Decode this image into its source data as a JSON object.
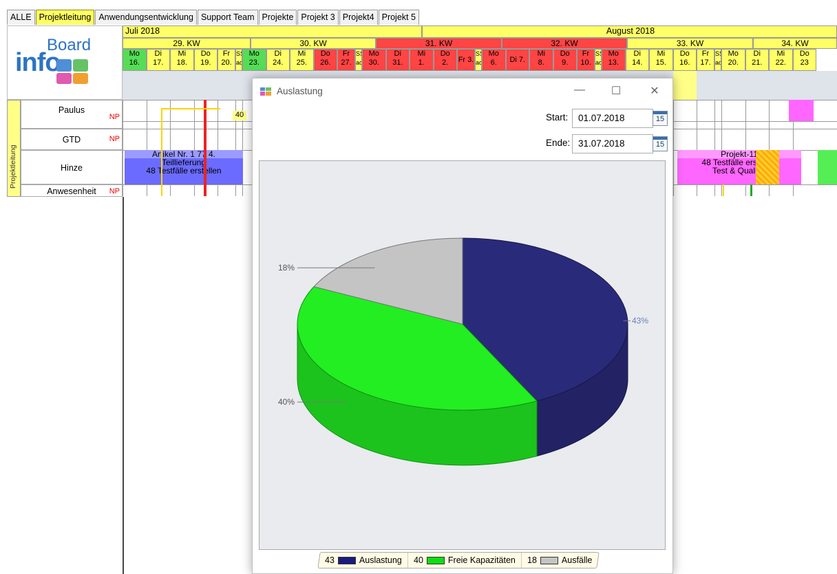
{
  "tabs": [
    {
      "label": "ALLE",
      "active": false
    },
    {
      "label": "Projektleitung",
      "active": true
    },
    {
      "label": "Anwendungsentwicklung",
      "active": false
    },
    {
      "label": "Support Team",
      "active": false
    },
    {
      "label": "Projekte",
      "active": false
    },
    {
      "label": "Projekt 3",
      "active": false
    },
    {
      "label": "Projekt4",
      "active": false
    },
    {
      "label": "Projekt 5",
      "active": false
    }
  ],
  "logo": {
    "word1": "Board",
    "word2": "info"
  },
  "group_label": "Projektleitung",
  "rows": [
    {
      "name": "Paulus",
      "np": "NP"
    },
    {
      "name": "GTD",
      "np": "NP"
    },
    {
      "name": "Hinze",
      "np": ""
    },
    {
      "name": "Anwesenheit",
      "np": "NP"
    }
  ],
  "calendar": {
    "months": [
      "Juli 2018",
      "August 2018"
    ],
    "weeks": [
      {
        "label": "29. KW",
        "color": "#ffff66"
      },
      {
        "label": "30. KW",
        "color": "#ffff66"
      },
      {
        "label": "31. KW",
        "color": "#ff4444"
      },
      {
        "label": "32. KW",
        "color": "#ff4444"
      },
      {
        "label": "33. KW",
        "color": "#ffff66"
      },
      {
        "label": "34. KW",
        "color": "#ffff66"
      }
    ],
    "days": [
      {
        "t": "Mo\n16.",
        "c": "#55dd55"
      },
      {
        "t": "Di\n17.",
        "c": "#ffff66"
      },
      {
        "t": "Mi\n18.",
        "c": "#ffff66"
      },
      {
        "t": "Do\n19.",
        "c": "#ffff66"
      },
      {
        "t": "Fr\n20.",
        "c": "#ffff66"
      },
      {
        "t": "SS\nao",
        "c": "#ffff66"
      },
      {
        "t": "Mo\n23.",
        "c": "#55dd55"
      },
      {
        "t": "Di\n24.",
        "c": "#ffff66"
      },
      {
        "t": "Mi\n25.",
        "c": "#ffff66"
      },
      {
        "t": "Do\n26.",
        "c": "#ff4444"
      },
      {
        "t": "Fr\n27.",
        "c": "#ff4444"
      },
      {
        "t": "SS\nao",
        "c": "#ffff66"
      },
      {
        "t": "Mo\n30.",
        "c": "#ff4444"
      },
      {
        "t": "Di\n31.",
        "c": "#ff4444"
      },
      {
        "t": "Mi\n1.",
        "c": "#ff4444"
      },
      {
        "t": "Do\n2.",
        "c": "#ff4444"
      },
      {
        "t": "Fr 3.",
        "c": "#ff4444"
      },
      {
        "t": "SS\nao",
        "c": "#ffff66"
      },
      {
        "t": "Mo\n6.",
        "c": "#ff4444"
      },
      {
        "t": "Di 7.",
        "c": "#ff4444"
      },
      {
        "t": "Mi\n8.",
        "c": "#ff4444"
      },
      {
        "t": "Do\n9.",
        "c": "#ff4444"
      },
      {
        "t": "Fr\n10.",
        "c": "#ff4444"
      },
      {
        "t": "SS\nao",
        "c": "#ffff66"
      },
      {
        "t": "Mo\n13.",
        "c": "#ff4444"
      },
      {
        "t": "Di\n14.",
        "c": "#ffff66"
      },
      {
        "t": "Mi\n15.",
        "c": "#ffff66"
      },
      {
        "t": "Do\n16.",
        "c": "#ffff66"
      },
      {
        "t": "Fr\n17.",
        "c": "#ffff66"
      },
      {
        "t": "SS\nao",
        "c": "#ffff66"
      },
      {
        "t": "Mo\n20.",
        "c": "#ffff66"
      },
      {
        "t": "Di\n21.",
        "c": "#ffff66"
      },
      {
        "t": "Mi\n22.",
        "c": "#ffff66"
      },
      {
        "t": "Do\n23",
        "c": "#ffff66"
      }
    ]
  },
  "bars": {
    "hinze_left": {
      "line1": "Artikel Nr. 1 77 4.",
      "line2": "Teillieferung",
      "line3": "48  Testfälle erstellen",
      "color": "#6b6bff"
    },
    "hinze_right": {
      "line1": "Projekt-11",
      "line2": "48  Testfälle erstellen",
      "line3": "Test & Qualität",
      "color": "#ff66ff"
    },
    "paulus_marker": "40"
  },
  "dialog": {
    "title": "Auslastung",
    "start_label": "Start:",
    "start_value": "01.07.2018",
    "end_label": "Ende:",
    "end_value": "31.07.2018",
    "cal_icon_num": "15",
    "minimize": "—",
    "maximize": "☐",
    "close": "✕"
  },
  "chart_data": {
    "type": "pie",
    "three_d": true,
    "series": [
      {
        "name": "Auslastung",
        "value": 43,
        "label": "43%",
        "color": "#2a2a7a"
      },
      {
        "name": "Freie Kapazitäten",
        "value": 40,
        "label": "40%",
        "color": "#22ee22"
      },
      {
        "name": "Ausfälle",
        "value": 18,
        "label": "18%",
        "color": "#c4c4c4"
      }
    ],
    "legend": [
      {
        "count": "43",
        "name": "Auslastung",
        "color": "#1a1a80"
      },
      {
        "count": "40",
        "name": "Freie Kapazitäten",
        "color": "#11dd11"
      },
      {
        "count": "18",
        "name": "Ausfälle",
        "color": "#c4c4c4"
      }
    ],
    "legend_position": "bottom"
  }
}
